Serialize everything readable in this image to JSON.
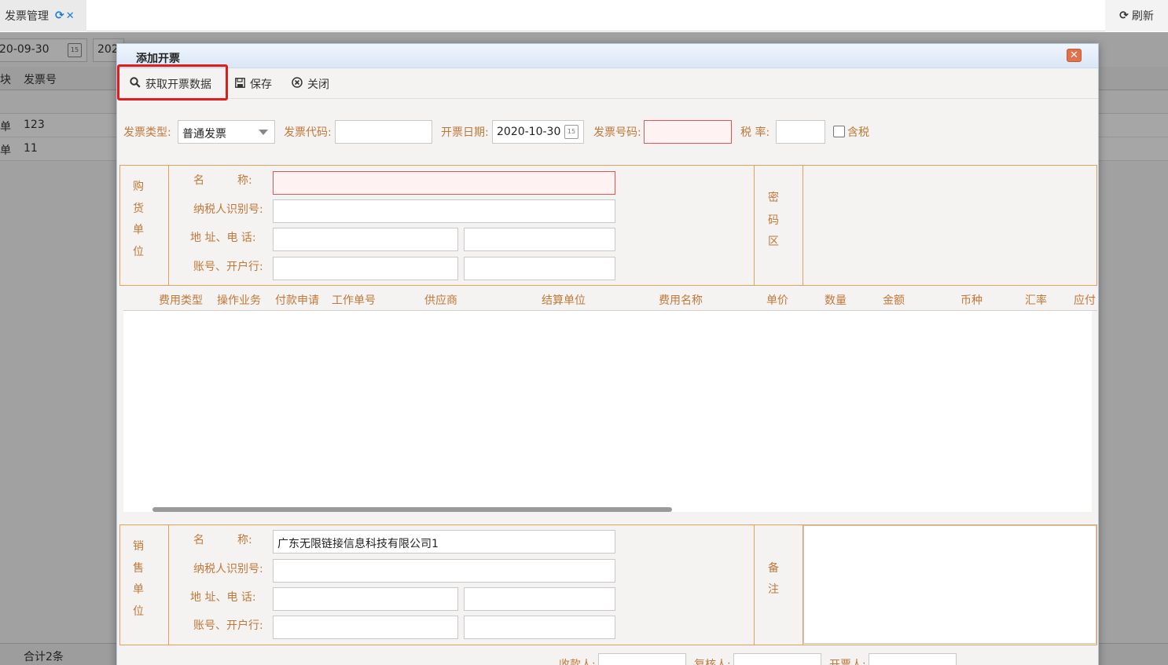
{
  "page_tab": {
    "label": "发票管理"
  },
  "refresh": {
    "label": "刷新"
  },
  "background": {
    "date_start": "20-09-30",
    "date_end": "202",
    "col_block": "块",
    "col_invoice_no": "发票号",
    "rows": [
      {
        "block": "单",
        "invoice_no": "123"
      },
      {
        "block": "单",
        "invoice_no": "11"
      }
    ],
    "total": "合计2条"
  },
  "dialog": {
    "title": "添加开票",
    "toolbar": {
      "fetch_label": "获取开票数据",
      "save_label": "保存",
      "close_label": "关闭"
    },
    "form": {
      "invoice_type_label": "发票类型:",
      "invoice_type_value": "普通发票",
      "invoice_code_label": "发票代码:",
      "invoice_date_label": "开票日期:",
      "invoice_date_value": "2020-10-30",
      "invoice_number_label": "发票号码:",
      "tax_rate_label": "税 率:",
      "tax_included_label": "含税"
    },
    "buyer": {
      "side_chars": [
        "购",
        "货",
        "单",
        "位"
      ],
      "name_label": "名　　　称:",
      "tax_id_label": "纳税人识别号:",
      "address_label": "地 址、电 话:",
      "account_label": "账号、开户行:",
      "name_value": "",
      "password_chars": [
        "密",
        "码",
        "区"
      ]
    },
    "grid_columns": [
      "费用类型",
      "操作业务",
      "付款申请",
      "工作单号",
      "供应商",
      "结算单位",
      "费用名称",
      "单价",
      "数量",
      "金额",
      "币种",
      "汇率",
      "应付"
    ],
    "seller": {
      "side_chars": [
        "销",
        "售",
        "单",
        "位"
      ],
      "name_label": "名　　　称:",
      "tax_id_label": "纳税人识别号:",
      "address_label": "地 址、电 话:",
      "account_label": "账号、开户行:",
      "name_value": "广东无限链接信息科技有限公司1",
      "remark_chars": [
        "备",
        "注"
      ]
    },
    "footer": {
      "payee_label": "收款人:",
      "reviewer_label": "复核人:",
      "issuer_label": "开票人:"
    }
  }
}
